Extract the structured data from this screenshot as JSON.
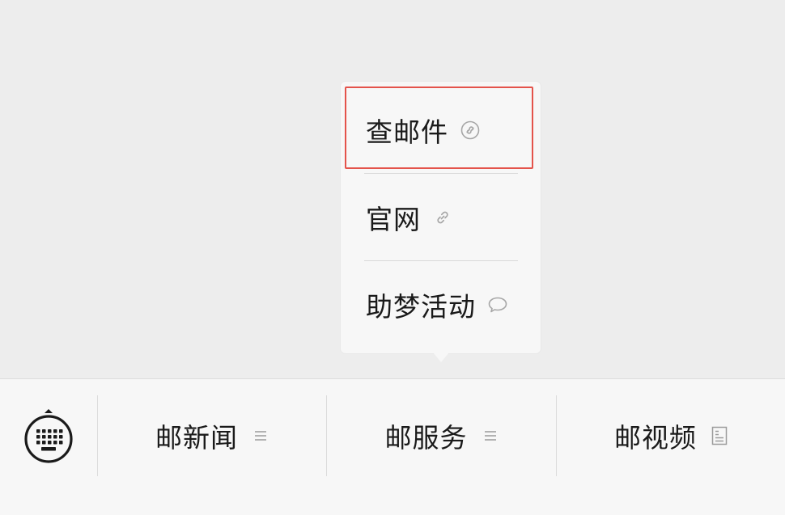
{
  "menu": {
    "items": [
      {
        "label": "查邮件",
        "icon": "mini-program-icon"
      },
      {
        "label": "官网",
        "icon": "link-icon"
      },
      {
        "label": "助梦活动",
        "icon": "chat-bubble-icon"
      }
    ],
    "highlighted_index": 0,
    "highlight_color": "#e4534b"
  },
  "bottom_bar": {
    "keyboard_icon": "keyboard-icon",
    "tabs": [
      {
        "label": "邮新闻",
        "icon": "menu-lines-icon"
      },
      {
        "label": "邮服务",
        "icon": "menu-lines-icon"
      },
      {
        "label": "邮视频",
        "icon": "document-icon"
      }
    ]
  },
  "colors": {
    "background": "#ededed",
    "bar_background": "#f7f7f7",
    "text": "#1a1a1a",
    "icon_gray": "#9b9b9b"
  }
}
